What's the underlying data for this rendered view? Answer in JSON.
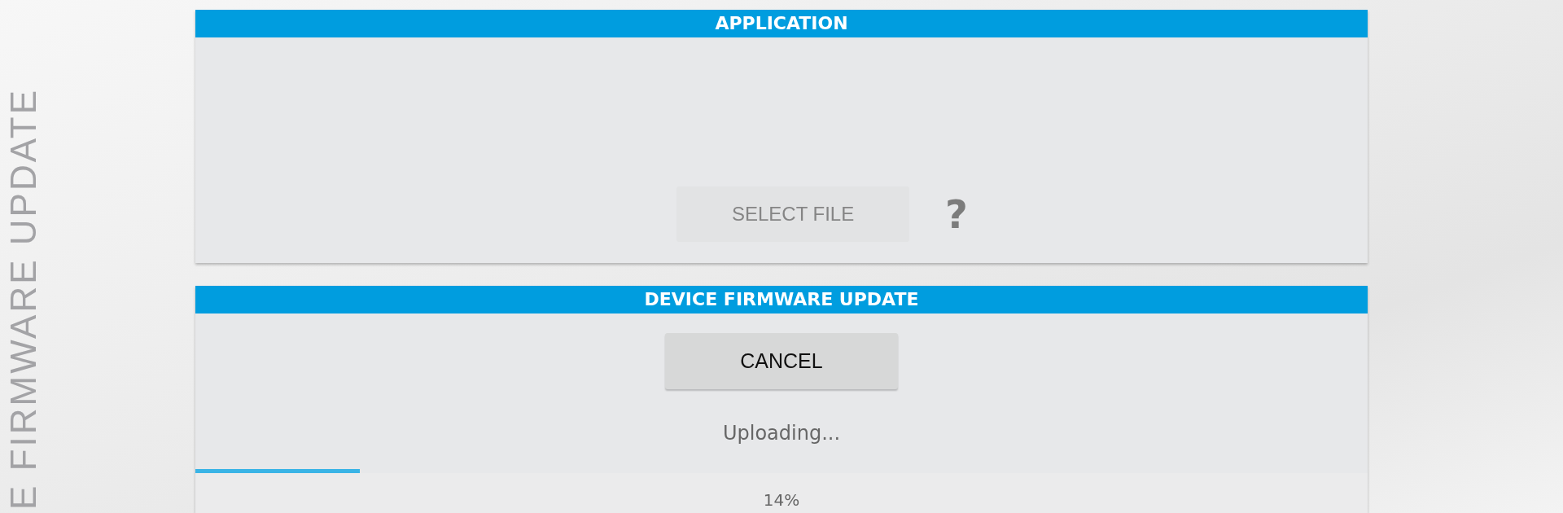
{
  "side_title": "E FIRMWARE UPDATE",
  "application": {
    "title": "APPLICATION",
    "select_button": "SELECT FILE",
    "select_disabled": true,
    "help": "?"
  },
  "firmware": {
    "title": "DEVICE FIRMWARE UPDATE",
    "cancel_button": "CANCEL",
    "status": "Uploading...",
    "progress": {
      "level": 0.14
    },
    "percent": "14%"
  }
}
